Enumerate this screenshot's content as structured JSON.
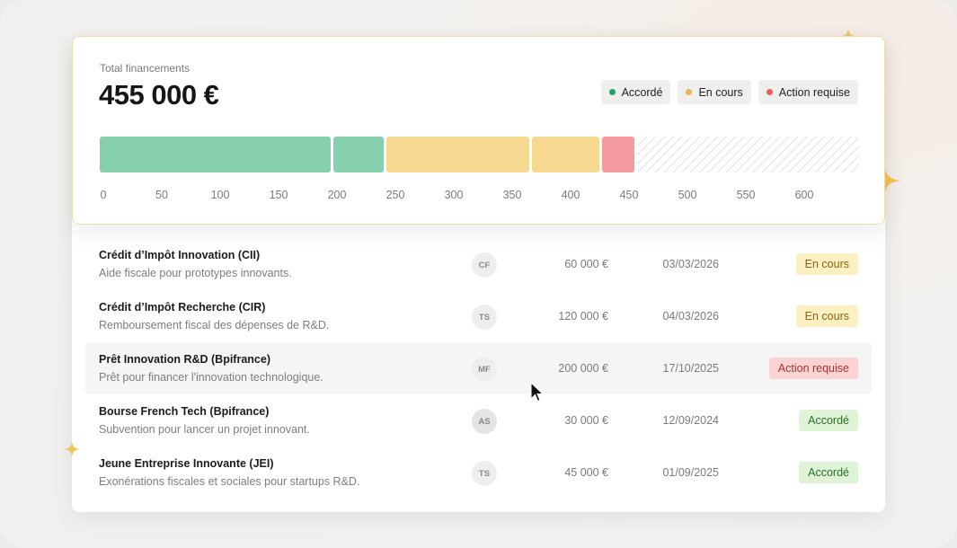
{
  "summary": {
    "total_label": "Total financements",
    "total_value": "455 000 €",
    "legend": [
      {
        "label": "Accordé",
        "color": "#22a06b"
      },
      {
        "label": "En cours",
        "color": "#f0b44c"
      },
      {
        "label": "Action requise",
        "color": "#ef5b5b"
      }
    ],
    "scale": {
      "min": 0,
      "max": 650
    },
    "ticks": [
      "0",
      "50",
      "100",
      "150",
      "200",
      "250",
      "300",
      "350",
      "400",
      "450",
      "500",
      "550",
      "600"
    ],
    "segments": [
      {
        "status": "Accordé",
        "value": 200,
        "color": "#87d0ae"
      },
      {
        "status": "Accordé",
        "value": 45,
        "color": "#87d0ae"
      },
      {
        "status": "En cours",
        "value": 125,
        "color": "#f6d891"
      },
      {
        "status": "En cours",
        "value": 60,
        "color": "#f6d891"
      },
      {
        "status": "Action requise",
        "value": 30,
        "color": "#f59a9e"
      }
    ]
  },
  "rows": [
    {
      "title": "Crédit d’Impôt Innovation (CII)",
      "desc": "Aide fiscale pour prototypes innovants.",
      "initials": "CF",
      "amount": "60 000 €",
      "date": "03/03/2026",
      "status": "En cours",
      "status_bg": "#fcefc1",
      "status_fg": "#8a6410",
      "highlight": false
    },
    {
      "title": "Crédit d’Impôt Recherche (CIR)",
      "desc": "Remboursement fiscal des dépenses de R&D.",
      "initials": "TS",
      "amount": "120 000 €",
      "date": "04/03/2026",
      "status": "En cours",
      "status_bg": "#fcefc1",
      "status_fg": "#8a6410",
      "highlight": false
    },
    {
      "title": "Prêt Innovation R&D (Bpifrance)",
      "desc": "Prêt pour financer l'innovation technologique.",
      "initials": "MF",
      "amount": "200 000 €",
      "date": "17/10/2025",
      "status": "Action requise",
      "status_bg": "#fbd3d3",
      "status_fg": "#b0302f",
      "highlight": true
    },
    {
      "title": "Bourse French Tech (Bpifrance)",
      "desc": "Subvention pour lancer un projet innovant.",
      "initials": "AS",
      "amount": "30 000 €",
      "date": "12/09/2024",
      "status": "Accordé",
      "status_bg": "#dff4d6",
      "status_fg": "#2e6b28",
      "highlight": false
    },
    {
      "title": "Jeune Entreprise Innovante (JEI)",
      "desc": "Exonérations fiscales et sociales pour startups R&D.",
      "initials": "TS",
      "amount": "45 000 €",
      "date": "01/09/2025",
      "status": "Accordé",
      "status_bg": "#dff4d6",
      "status_fg": "#2e6b28",
      "highlight": false
    }
  ]
}
